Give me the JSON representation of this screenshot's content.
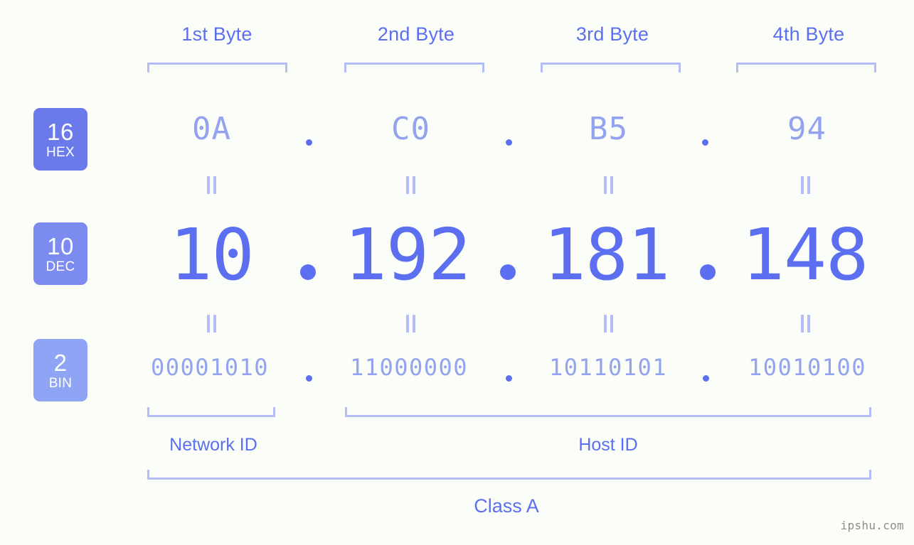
{
  "diagram": {
    "title": "IPv4 address byte breakdown",
    "ip_address": "10.192.181.148",
    "ip_class": "Class A",
    "colors": {
      "background": "#fbfdf8",
      "accent_strong": "#5b6ff0",
      "accent_light": "#94a3f0",
      "bracket": "#b4bdf5",
      "badge_hex": "#6b7aea",
      "badge_dec": "#7b8bef",
      "badge_bin": "#8fa4f5",
      "watermark": "#8d8d8d"
    }
  },
  "byte_headers": [
    {
      "label": "1st Byte"
    },
    {
      "label": "2nd Byte"
    },
    {
      "label": "3rd Byte"
    },
    {
      "label": "4th Byte"
    }
  ],
  "rows": [
    {
      "badge_num": "16",
      "badge_name": "HEX",
      "values": [
        "0A",
        "C0",
        "B5",
        "94"
      ],
      "separator": "."
    },
    {
      "badge_num": "10",
      "badge_name": "DEC",
      "values": [
        "10",
        "192",
        "181",
        "148"
      ],
      "separator": "."
    },
    {
      "badge_num": "2",
      "badge_name": "BIN",
      "values": [
        "00001010",
        "11000000",
        "10110101",
        "10010100"
      ],
      "separator": "."
    }
  ],
  "equality_symbol": "=",
  "regions": [
    {
      "label": "Network ID",
      "bytes": 1
    },
    {
      "label": "Host ID",
      "bytes": 3
    }
  ],
  "class_section": {
    "label": "Class A"
  },
  "watermark": {
    "text": "ipshu.com"
  }
}
